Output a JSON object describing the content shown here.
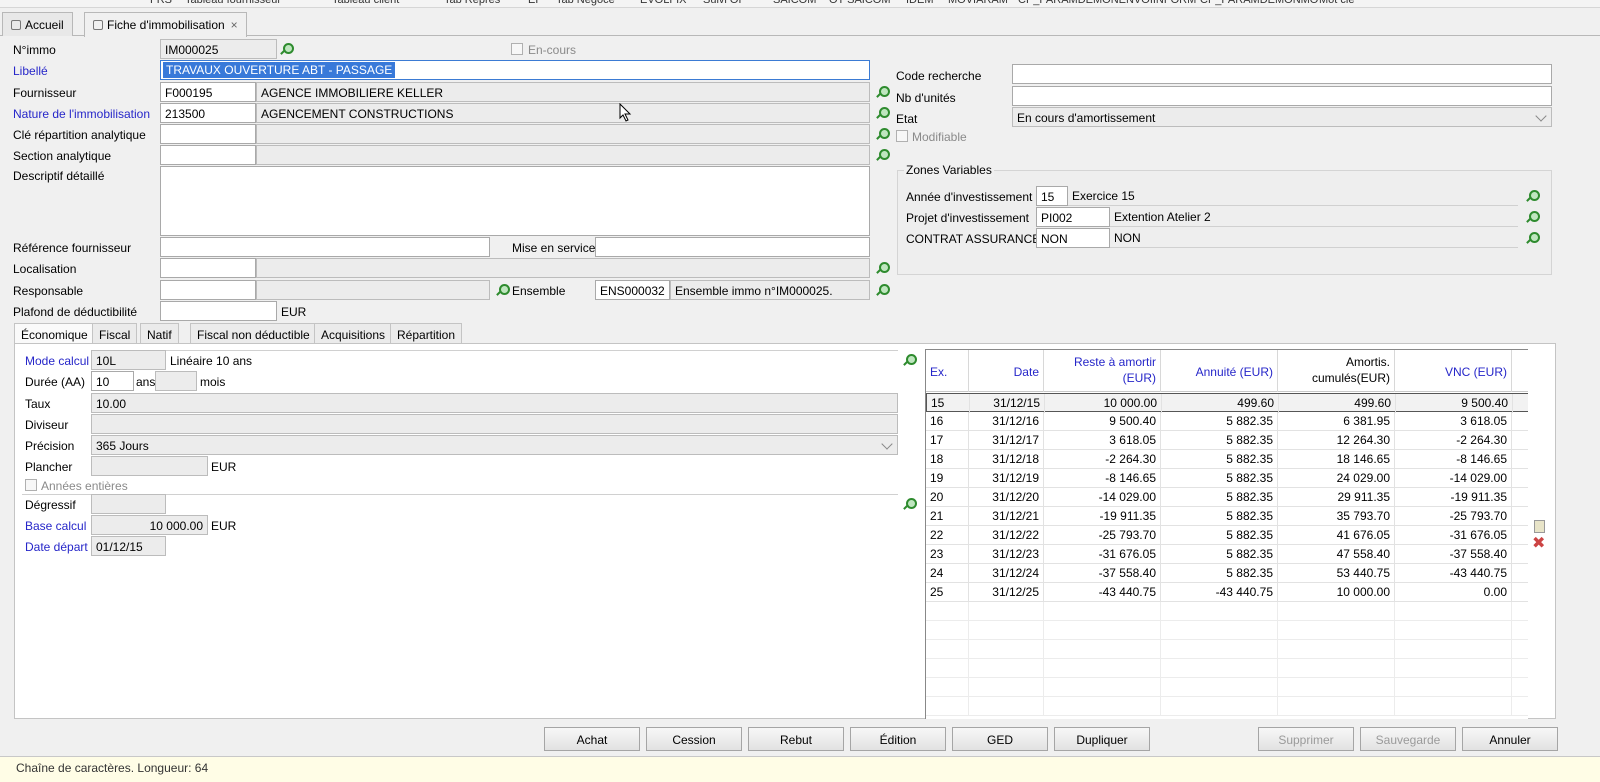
{
  "toolbar": {
    "items": [
      "FRS",
      "Tableau fournisseur",
      "Tableau client",
      "Tab Repres",
      "EF",
      "Tab Negoce",
      "EVOLFIX",
      "Suivi OF",
      "SAICOM",
      "OT SAICOM",
      "IDEM",
      "MOVIARAM",
      "CP_PARAMDEMONENVOIINFORM",
      "CP_PARAMDEMONMO",
      "Mot clé"
    ]
  },
  "tabs": [
    {
      "label": "Accueil"
    },
    {
      "label": "Fiche d'immobilisation",
      "close": "×"
    }
  ],
  "form": {
    "numimmo_label": "N°immo",
    "numimmo_value": "IM000025",
    "encours_label": "En-cours",
    "libelle_label": "Libellé",
    "libelle_value": "TRAVAUX OUVERTURE ABT - PASSAGE",
    "fournisseur_label": "Fournisseur",
    "fournisseur_code": "F000195",
    "fournisseur_name": "AGENCE IMMOBILIERE KELLER",
    "nature_label": "Nature de l'immobilisation",
    "nature_code": "213500",
    "nature_name": "AGENCEMENT CONSTRUCTIONS",
    "cle_label": "Clé répartition analytique",
    "section_label": "Section analytique",
    "descriptif_label": "Descriptif détaillé",
    "ref_fournisseur_label": "Référence fournisseur",
    "mise_service_label": "Mise en service",
    "localisation_label": "Localisation",
    "responsable_label": "Responsable",
    "ensemble_label": "Ensemble",
    "ensemble_code": "ENS000032",
    "ensemble_name": "Ensemble immo n°IM000025.",
    "plafond_label": "Plafond de déductibilité",
    "plafond_unit": "EUR",
    "code_recherche_label": "Code recherche",
    "nb_unites_label": "Nb d'unités",
    "etat_label": "Etat",
    "etat_value": "En cours d'amortissement",
    "modifiable_label": "Modifiable"
  },
  "zones": {
    "title": "Zones Variables",
    "rows": [
      {
        "label": "Année d'investissement",
        "code": "15",
        "value": "Exercice 15"
      },
      {
        "label": "Projet d'investissement",
        "code": "PI002",
        "value": "Extention Atelier 2"
      },
      {
        "label": "CONTRAT ASSURANCE",
        "code": "NON",
        "value": "NON"
      }
    ]
  },
  "subtabs": [
    "Économique",
    "Fiscal",
    "Natif",
    "Fiscal non déductible",
    "Acquisitions",
    "Répartition"
  ],
  "eco": {
    "mode_label": "Mode calcul",
    "mode_code": "10L",
    "mode_name": "Linéaire 10 ans",
    "duree_label": "Durée (AA)",
    "duree_value": "10",
    "ans_label": "ans",
    "mois_label": "mois",
    "taux_label": "Taux",
    "taux_value": "10.00",
    "diviseur_label": "Diviseur",
    "precision_label": "Précision",
    "precision_value": "365 Jours",
    "plancher_label": "Plancher",
    "plancher_unit": "EUR",
    "annees_label": "Années entières",
    "degressif_label": "Dégressif",
    "base_label": "Base calcul",
    "base_value": "10 000.00",
    "base_unit": "EUR",
    "date_label": "Date départ",
    "date_value": "01/12/15"
  },
  "table": {
    "headers": [
      "Ex.",
      "Date",
      "Reste à amortir (EUR)",
      "Annuité (EUR)",
      "Amortis. cumulés(EUR)",
      "VNC (EUR)"
    ],
    "rows": [
      [
        "15",
        "31/12/15",
        "10 000.00",
        "499.60",
        "499.60",
        "9 500.40"
      ],
      [
        "16",
        "31/12/16",
        "9 500.40",
        "5 882.35",
        "6 381.95",
        "3 618.05"
      ],
      [
        "17",
        "31/12/17",
        "3 618.05",
        "5 882.35",
        "12 264.30",
        "-2 264.30"
      ],
      [
        "18",
        "31/12/18",
        "-2 264.30",
        "5 882.35",
        "18 146.65",
        "-8 146.65"
      ],
      [
        "19",
        "31/12/19",
        "-8 146.65",
        "5 882.35",
        "24 029.00",
        "-14 029.00"
      ],
      [
        "20",
        "31/12/20",
        "-14 029.00",
        "5 882.35",
        "29 911.35",
        "-19 911.35"
      ],
      [
        "21",
        "31/12/21",
        "-19 911.35",
        "5 882.35",
        "35 793.70",
        "-25 793.70"
      ],
      [
        "22",
        "31/12/22",
        "-25 793.70",
        "5 882.35",
        "41 676.05",
        "-31 676.05"
      ],
      [
        "23",
        "31/12/23",
        "-31 676.05",
        "5 882.35",
        "47 558.40",
        "-37 558.40"
      ],
      [
        "24",
        "31/12/24",
        "-37 558.40",
        "5 882.35",
        "53 440.75",
        "-43 440.75"
      ],
      [
        "25",
        "31/12/25",
        "-43 440.75",
        "-43 440.75",
        "10 000.00",
        "0.00"
      ]
    ]
  },
  "buttons": {
    "achat": "Achat",
    "cession": "Cession",
    "rebut": "Rebut",
    "edition": "Édition",
    "ged": "GED",
    "dupliquer": "Dupliquer",
    "supprimer": "Supprimer",
    "sauvegarde": "Sauvegarde",
    "annuler": "Annuler"
  },
  "status": {
    "text": "Chaîne de caractères. Longueur: 64"
  }
}
